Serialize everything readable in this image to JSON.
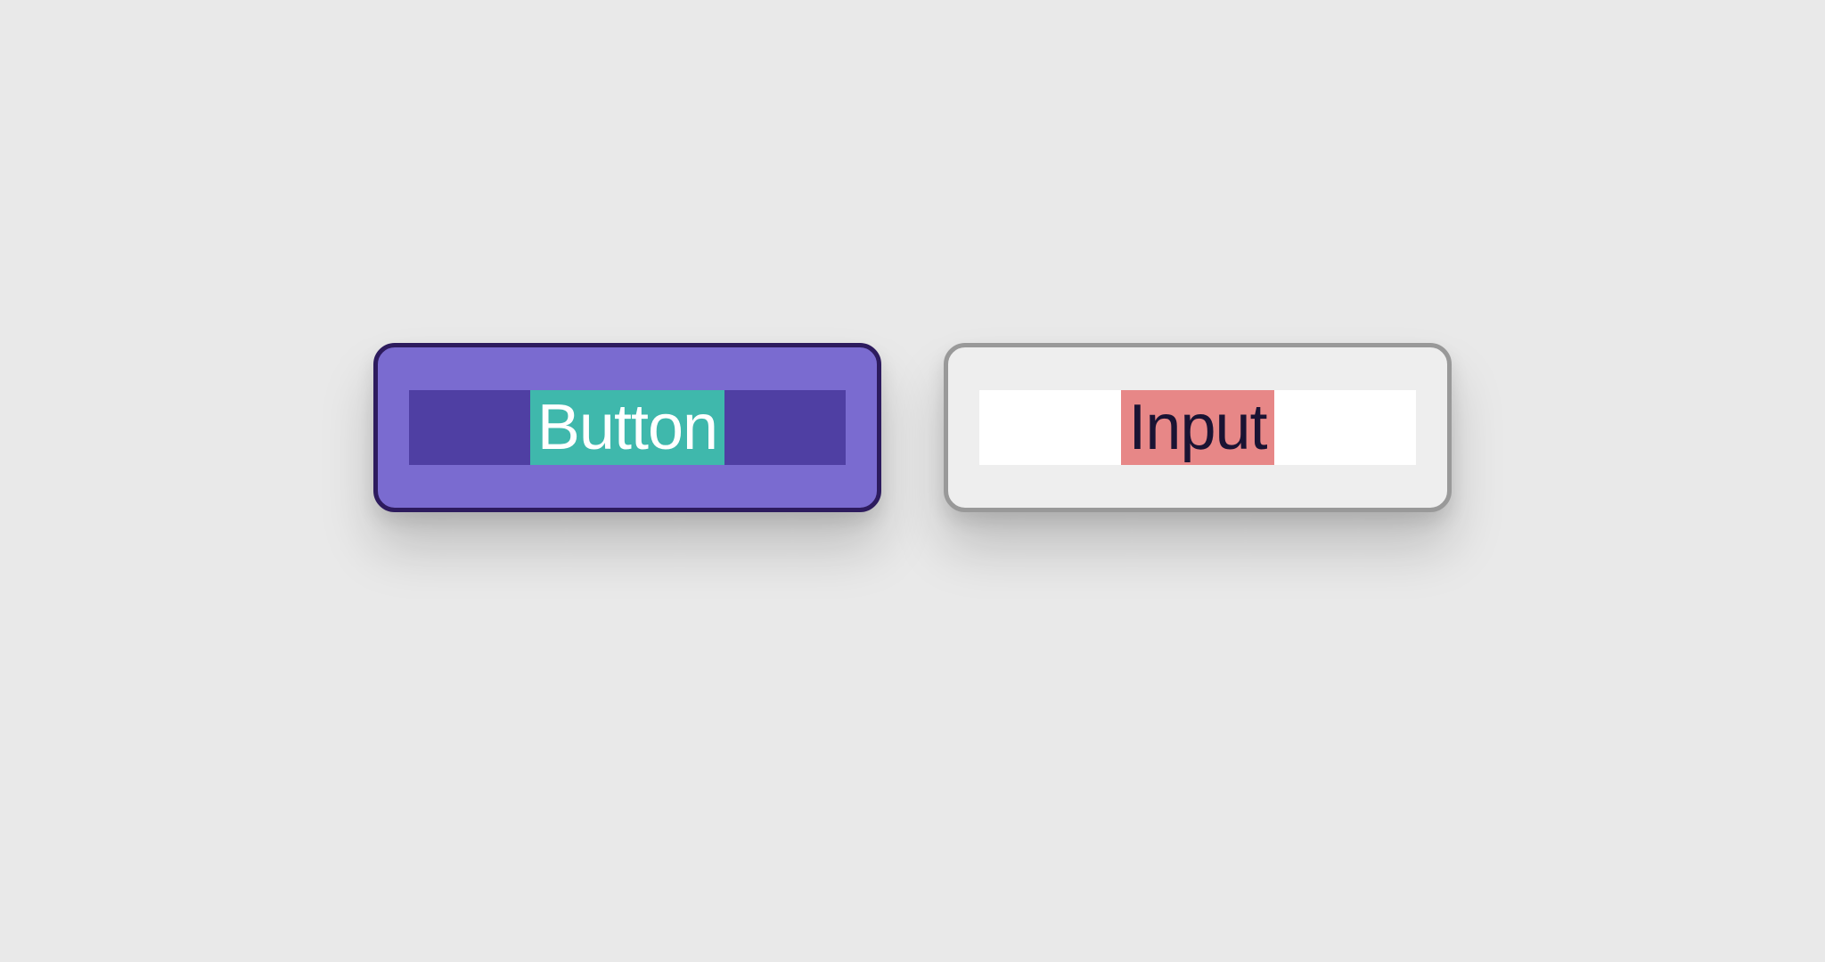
{
  "diagram": {
    "button": {
      "label": "Button",
      "colors": {
        "outer_fill": "#7a6bd0",
        "border": "#2d1b5e",
        "inner_bar": "#4f3fa3",
        "highlight": "#3fb8ac",
        "text": "#ffffff"
      }
    },
    "input": {
      "label": "Input",
      "colors": {
        "outer_fill": "#eeeeee",
        "border": "#999999",
        "inner_bar": "#ffffff",
        "highlight": "#e78787",
        "text": "#1a1333"
      }
    }
  }
}
